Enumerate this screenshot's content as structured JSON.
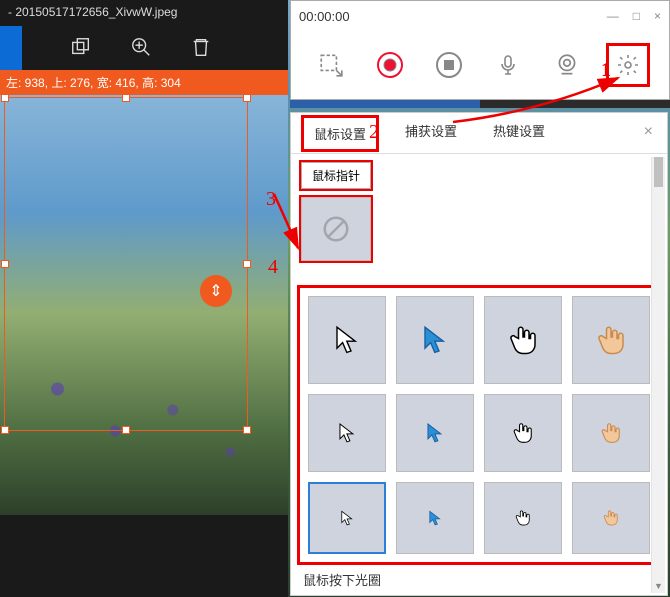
{
  "recorder": {
    "time": "00:00:00",
    "win": {
      "min": "—",
      "max": "□",
      "close": "×"
    },
    "toolbar": {
      "region": "region-icon",
      "record": "record-icon",
      "stop": "stop-icon",
      "mic": "mic-icon",
      "webcam": "webcam-icon",
      "settings": "settings-icon"
    }
  },
  "editor": {
    "title": "- 20150517172656_XivwW.jpeg",
    "crop_info": "左: 938, 上: 276, 宽: 416, 高: 304",
    "badge_glyph": "⇕"
  },
  "settings": {
    "tabs": [
      "鼠标设置",
      "捕获设置",
      "热键设置"
    ],
    "active_tab_index": 0,
    "sub_tab": "鼠标指针",
    "footer": "鼠标按下光圈",
    "cursor_cells": [
      {
        "name": "cursor-arrow-white-lg",
        "sel": false
      },
      {
        "name": "cursor-arrow-blue-lg",
        "sel": false
      },
      {
        "name": "cursor-hand-white-lg",
        "sel": false
      },
      {
        "name": "cursor-hand-skin-lg",
        "sel": false
      },
      {
        "name": "cursor-arrow-white-md",
        "sel": false
      },
      {
        "name": "cursor-arrow-blue-md",
        "sel": false
      },
      {
        "name": "cursor-hand-white-md",
        "sel": false
      },
      {
        "name": "cursor-hand-skin-md",
        "sel": false
      },
      {
        "name": "cursor-arrow-white-sm",
        "sel": true
      },
      {
        "name": "cursor-arrow-blue-sm",
        "sel": false
      },
      {
        "name": "cursor-hand-white-sm",
        "sel": false
      },
      {
        "name": "cursor-hand-skin-sm",
        "sel": false
      }
    ]
  },
  "annotations": {
    "n1": "1",
    "n2": "2",
    "n3": "3",
    "n4": "4"
  }
}
